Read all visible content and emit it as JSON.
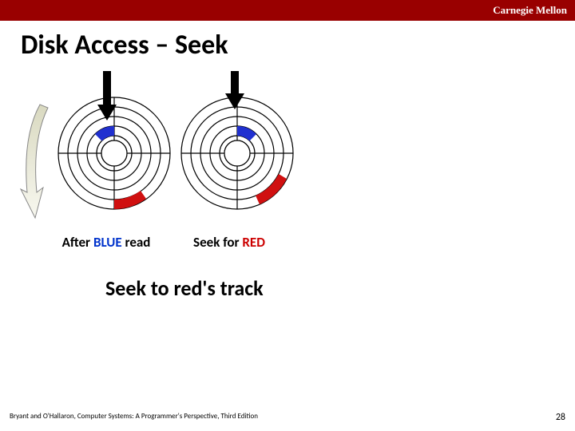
{
  "banner": {
    "org": "Carnegie Mellon"
  },
  "title": "Disk Access – Seek",
  "captions": {
    "left_prefix": "After ",
    "left_color": "BLUE",
    "left_suffix": " read",
    "right_prefix": "Seek for ",
    "right_color": "RED"
  },
  "subtitle": "Seek to red's track",
  "footer": {
    "credit": "Bryant and O'Hallaron, Computer Systems: A Programmer's Perspective, Third Edition",
    "page": "28"
  },
  "colors": {
    "banner": "#990000",
    "blue": "#2030d0",
    "red": "#d01010"
  }
}
